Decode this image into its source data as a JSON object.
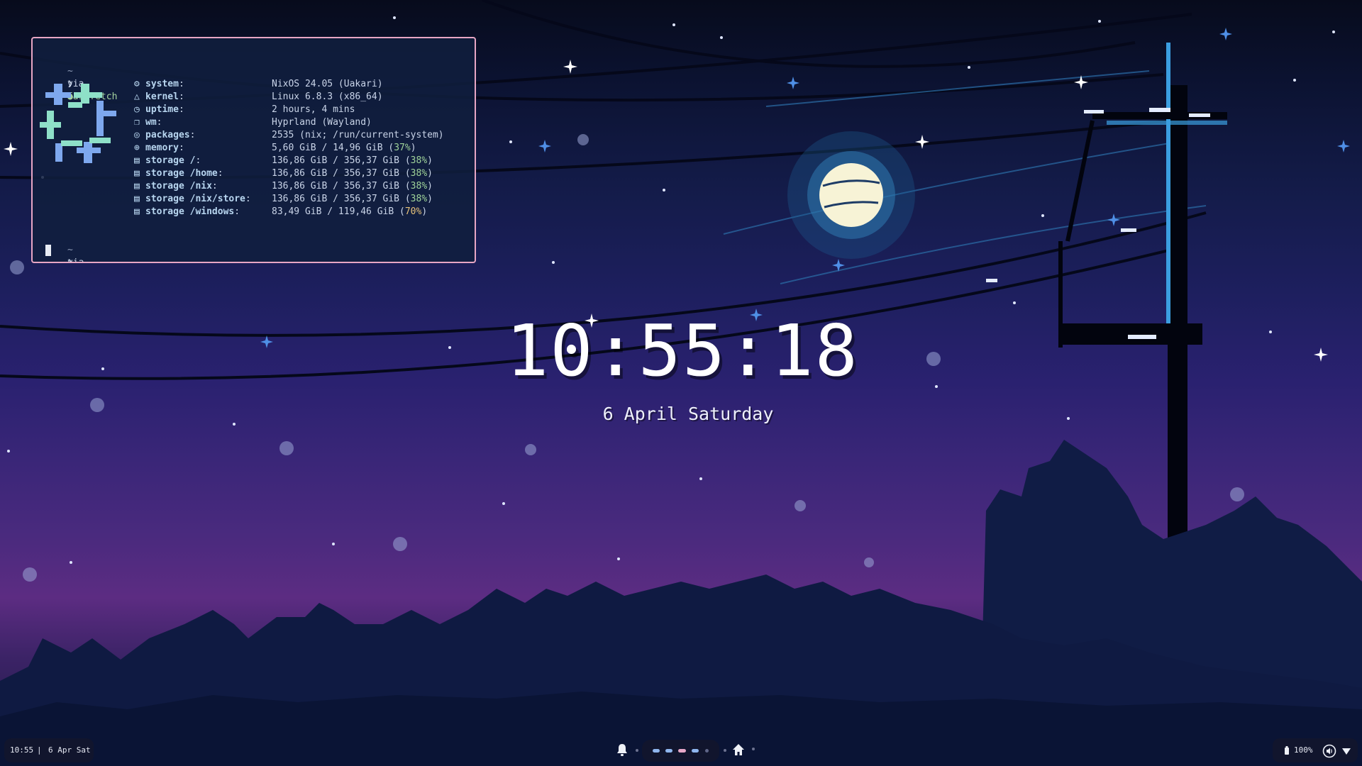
{
  "terminal": {
    "prompt_dir": "~",
    "prompt_via": "via",
    "command": "fastfetch",
    "prompt_symbol": "❯",
    "fastfetch": [
      {
        "icon": "gear-icon",
        "key": "system",
        "value": "NixOS 24.05 (Uakari)"
      },
      {
        "icon": "penguin-icon",
        "key": "kernel",
        "value": "Linux 6.8.3 (x86_64)"
      },
      {
        "icon": "clock-icon",
        "key": "uptime",
        "value": "2 hours, 4 mins"
      },
      {
        "icon": "windows-icon",
        "key": "wm",
        "value": "Hyprland (Wayland)"
      },
      {
        "icon": "package-icon",
        "key": "packages",
        "value": "2535 (nix; /run/current-system)"
      },
      {
        "icon": "memory-icon",
        "key": "memory",
        "value": "5,60 GiB / 14,96 GiB",
        "pct": "37%"
      },
      {
        "icon": "disk-icon",
        "key": "storage /",
        "value": "136,86 GiB / 356,37 GiB",
        "pct": "38%"
      },
      {
        "icon": "disk-icon",
        "key": "storage /home",
        "value": "136,86 GiB / 356,37 GiB",
        "pct": "38%"
      },
      {
        "icon": "disk-icon",
        "key": "storage /nix",
        "value": "136,86 GiB / 356,37 GiB",
        "pct": "38%"
      },
      {
        "icon": "disk-icon",
        "key": "storage /nix/store",
        "value": "136,86 GiB / 356,37 GiB",
        "pct": "38%"
      },
      {
        "icon": "disk-icon",
        "key": "storage /windows",
        "value": "83,49 GiB / 119,46 GiB",
        "pct": "70%"
      }
    ]
  },
  "lockscreen": {
    "time": "10:55:18",
    "date": "6 April Saturday"
  },
  "taskbar": {
    "left_time": "10:55",
    "separator": "|",
    "left_date": "6 Apr Sat",
    "workspaces": [
      {
        "color": "#8fb6ee"
      },
      {
        "color": "#8fb6ee"
      },
      {
        "color": "#e6a8c8"
      },
      {
        "color": "#8fb6ee"
      },
      {
        "color": "#5f6688"
      }
    ],
    "brightness_label": "100%"
  },
  "colors": {
    "terminal_border": "#e7a6c4",
    "accent_green": "#a6d4a0",
    "nix_blue": "#7ea8ee",
    "nix_mint": "#8ee0c8"
  }
}
